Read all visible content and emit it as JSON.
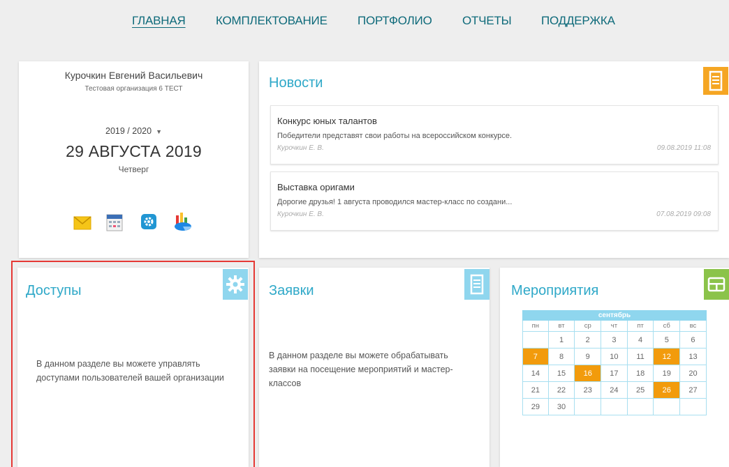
{
  "nav": {
    "items": [
      "ГЛАВНАЯ",
      "КОМПЛЕКТОВАНИЕ",
      "ПОРТФОЛИО",
      "ОТЧЕТЫ",
      "ПОДДЕРЖКА"
    ]
  },
  "profile": {
    "name": "Курочкин Евгений Васильевич",
    "organization": "Тестовая организация 6 ТЕСТ",
    "year": "2019 / 2020",
    "year_caret": "▼",
    "date": "29 АВГУСТА 2019",
    "weekday": "Четверг",
    "icons": [
      "mail-icon",
      "calendar-icon",
      "settings-icon",
      "chart-icon"
    ]
  },
  "news": {
    "title": "Новости",
    "icon": "news-icon",
    "items": [
      {
        "title": "Конкурс юных талантов",
        "description": "Победители представят свои работы на всероссийском конкурсе.",
        "author": "Курочкин Е. В.",
        "date": "09.08.2019 11:08"
      },
      {
        "title": "Выставка оригами",
        "description": "Дорогие друзья! 1 августа проводился мастер-класс по создани...",
        "author": "Курочкин Е. В.",
        "date": "07.08.2019 09:08"
      }
    ]
  },
  "access": {
    "title": "Доступы",
    "icon": "gear-icon",
    "description_1": "В данном разделе вы можете управлять",
    "description_2": "доступами пользователей вашей организации"
  },
  "requests": {
    "title": "Заявки",
    "icon": "document-icon",
    "description_1": "В данном разделе вы можете обрабатывать",
    "description_2": "заявки на посещение мероприятий и мастер-",
    "description_3": "классов"
  },
  "events": {
    "title": "Мероприятия",
    "icon": "board-icon",
    "calendar": {
      "month": "сентябрь",
      "weekdays": [
        "пн",
        "вт",
        "ср",
        "чт",
        "пт",
        "сб",
        "вс"
      ],
      "weeks": [
        [
          "",
          "1",
          "2",
          "3",
          "4",
          "5",
          "6"
        ],
        [
          "7",
          "8",
          "9",
          "10",
          "11",
          "12",
          "13"
        ],
        [
          "14",
          "15",
          "16",
          "17",
          "18",
          "19",
          "20"
        ],
        [
          "21",
          "22",
          "23",
          "24",
          "25",
          "26",
          "27"
        ],
        [
          "29",
          "30",
          "",
          "",
          "",
          "",
          ""
        ]
      ],
      "highlighted": [
        "7",
        "12",
        "16",
        "26"
      ]
    }
  },
  "colors": {
    "accent": "#2ea8c8",
    "nav": "#0e6a7a",
    "orange": "#f29b0c",
    "green": "#8bc34a",
    "light_blue": "#8fd6ee",
    "selection": "#e53935"
  }
}
